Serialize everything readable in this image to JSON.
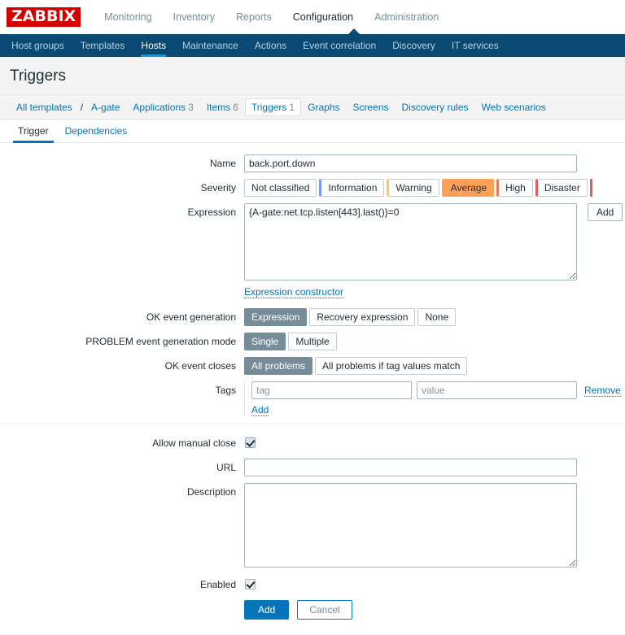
{
  "brand": {
    "logo_text": "ZABBIX",
    "logo_bg": "#d40000"
  },
  "topmenu": {
    "items": [
      {
        "label": "Monitoring",
        "selected": false
      },
      {
        "label": "Inventory",
        "selected": false
      },
      {
        "label": "Reports",
        "selected": false
      },
      {
        "label": "Configuration",
        "selected": true
      },
      {
        "label": "Administration",
        "selected": false
      }
    ]
  },
  "subnav": {
    "bg": "#0a4a72",
    "active_underline": "#00a1df",
    "items": [
      {
        "label": "Host groups",
        "active": false
      },
      {
        "label": "Templates",
        "active": false
      },
      {
        "label": "Hosts",
        "active": true
      },
      {
        "label": "Maintenance",
        "active": false
      },
      {
        "label": "Actions",
        "active": false
      },
      {
        "label": "Event correlation",
        "active": false
      },
      {
        "label": "Discovery",
        "active": false
      },
      {
        "label": "IT services",
        "active": false
      }
    ]
  },
  "page": {
    "title": "Triggers"
  },
  "breadcrumb": {
    "root": "All templates",
    "separator": "/",
    "host": "A-gate"
  },
  "objtabs": [
    {
      "label": "Applications",
      "count": "3",
      "selected": false
    },
    {
      "label": "Items",
      "count": "6",
      "selected": false
    },
    {
      "label": "Triggers",
      "count": "1",
      "selected": true
    },
    {
      "label": "Graphs",
      "count": "",
      "selected": false
    },
    {
      "label": "Screens",
      "count": "",
      "selected": false
    },
    {
      "label": "Discovery rules",
      "count": "",
      "selected": false
    },
    {
      "label": "Web scenarios",
      "count": "",
      "selected": false
    }
  ],
  "formtabs": [
    {
      "label": "Trigger",
      "active": true
    },
    {
      "label": "Dependencies",
      "active": false
    }
  ],
  "form": {
    "name": {
      "label": "Name",
      "value": "back.port.down"
    },
    "severity": {
      "label": "Severity",
      "options": [
        {
          "label": "Not classified",
          "selected": false,
          "accent": ""
        },
        {
          "label": "Information",
          "selected": false,
          "accent": "#7499ff"
        },
        {
          "label": "Warning",
          "selected": false,
          "accent": "#ffc859"
        },
        {
          "label": "Average",
          "selected": true,
          "accent": "#ffa059"
        },
        {
          "label": "High",
          "selected": false,
          "accent": "#e97659"
        },
        {
          "label": "Disaster",
          "selected": false,
          "accent": "#e45959"
        }
      ]
    },
    "expression": {
      "label": "Expression",
      "value": "{A-gate:net.tcp.listen[443].last()}=0",
      "add_button": "Add",
      "constructor_link": "Expression constructor"
    },
    "ok_event_generation": {
      "label": "OK event generation",
      "options": [
        {
          "label": "Expression",
          "selected": true
        },
        {
          "label": "Recovery expression",
          "selected": false
        },
        {
          "label": "None",
          "selected": false
        }
      ]
    },
    "problem_event_generation_mode": {
      "label": "PROBLEM event generation mode",
      "options": [
        {
          "label": "Single",
          "selected": true
        },
        {
          "label": "Multiple",
          "selected": false
        }
      ]
    },
    "ok_event_closes": {
      "label": "OK event closes",
      "options": [
        {
          "label": "All problems",
          "selected": true
        },
        {
          "label": "All problems if tag values match",
          "selected": false
        }
      ]
    },
    "tags": {
      "label": "Tags",
      "rows": [
        {
          "tag_placeholder": "tag",
          "tag_value": "",
          "value_placeholder": "value",
          "value_value": "",
          "remove_label": "Remove"
        }
      ],
      "add_label": "Add"
    },
    "allow_manual_close": {
      "label": "Allow manual close",
      "checked": true
    },
    "url": {
      "label": "URL",
      "value": ""
    },
    "description": {
      "label": "Description",
      "value": ""
    },
    "enabled": {
      "label": "Enabled",
      "checked": true
    }
  },
  "footer": {
    "submit_label": "Add",
    "cancel_label": "Cancel"
  }
}
